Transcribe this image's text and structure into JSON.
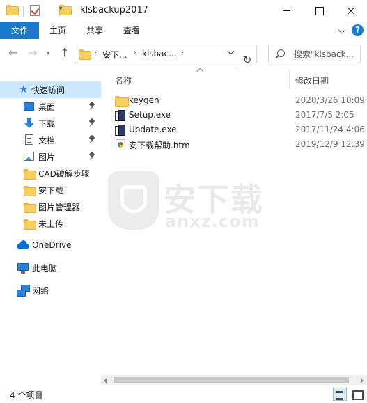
{
  "window": {
    "title": "klsbackup2017"
  },
  "ribbon": {
    "tabs": [
      {
        "label": "文件"
      },
      {
        "label": "主页"
      },
      {
        "label": "共享"
      },
      {
        "label": "查看"
      }
    ],
    "help_label": "?"
  },
  "address": {
    "crumbs": [
      "安下...",
      "klsbac..."
    ],
    "search_placeholder": "搜索\"klsback..."
  },
  "sidebar": {
    "items": [
      {
        "label": "快速访问",
        "icon": "star-icon",
        "selected": true
      },
      {
        "label": "桌面",
        "icon": "desktop-icon",
        "pinned": true
      },
      {
        "label": "下载",
        "icon": "download-icon",
        "pinned": true
      },
      {
        "label": "文档",
        "icon": "document-icon",
        "pinned": true
      },
      {
        "label": "图片",
        "icon": "pictures-icon",
        "pinned": true
      },
      {
        "label": "CAD破解步骤",
        "icon": "folder-icon"
      },
      {
        "label": "安下载",
        "icon": "folder-icon"
      },
      {
        "label": "图片管理器",
        "icon": "folder-icon"
      },
      {
        "label": "未上传",
        "icon": "folder-icon"
      },
      {
        "label": "OneDrive",
        "icon": "onedrive-icon"
      },
      {
        "label": "此电脑",
        "icon": "computer-icon"
      },
      {
        "label": "网络",
        "icon": "network-icon"
      }
    ]
  },
  "filelist": {
    "columns": {
      "name": "名称",
      "modified": "修改日期"
    },
    "rows": [
      {
        "name": "keygen",
        "modified": "2020/3/26 10:09",
        "icon": "folder-icon"
      },
      {
        "name": "Setup.exe",
        "modified": "2017/7/5 2:05",
        "icon": "exe-icon"
      },
      {
        "name": "Update.exe",
        "modified": "2017/11/24 4:06",
        "icon": "exe-icon"
      },
      {
        "name": "安下载帮助.htm",
        "modified": "2019/12/9 12:39",
        "icon": "htm-icon"
      }
    ],
    "watermark": {
      "cn": "安下载",
      "en": "anxz.com"
    }
  },
  "status": {
    "item_count": "4 个项目"
  },
  "colors": {
    "accent": "#1979ca",
    "selection": "#cce8ff",
    "folder": "#f7cf5f"
  }
}
